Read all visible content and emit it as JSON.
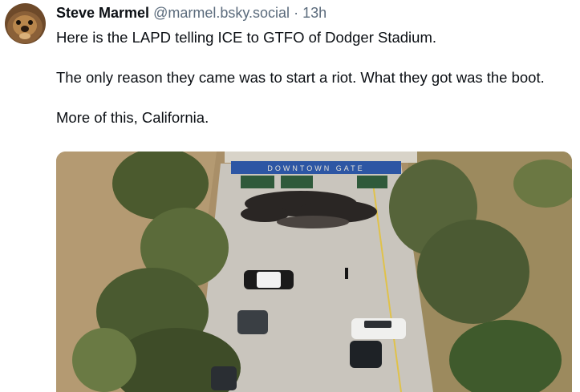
{
  "post": {
    "author_name": "Steve Marmel",
    "author_handle": "@marmel.bsky.social",
    "separator": "·",
    "time": "13h",
    "paragraphs": [
      "Here is the LAPD telling ICE to GTFO of Dodger Stadium.",
      "The only reason they came was to start a riot. What they got was the boot.",
      "More of this, California."
    ],
    "media": {
      "gate_sign": "DOWNTOWN GATE",
      "colors": {
        "road": "#c9c5bd",
        "hill": "#b49a72",
        "trees": "#5b6b3a",
        "sign": "#2d56a4",
        "sign_text": "#e8e4da"
      }
    }
  }
}
